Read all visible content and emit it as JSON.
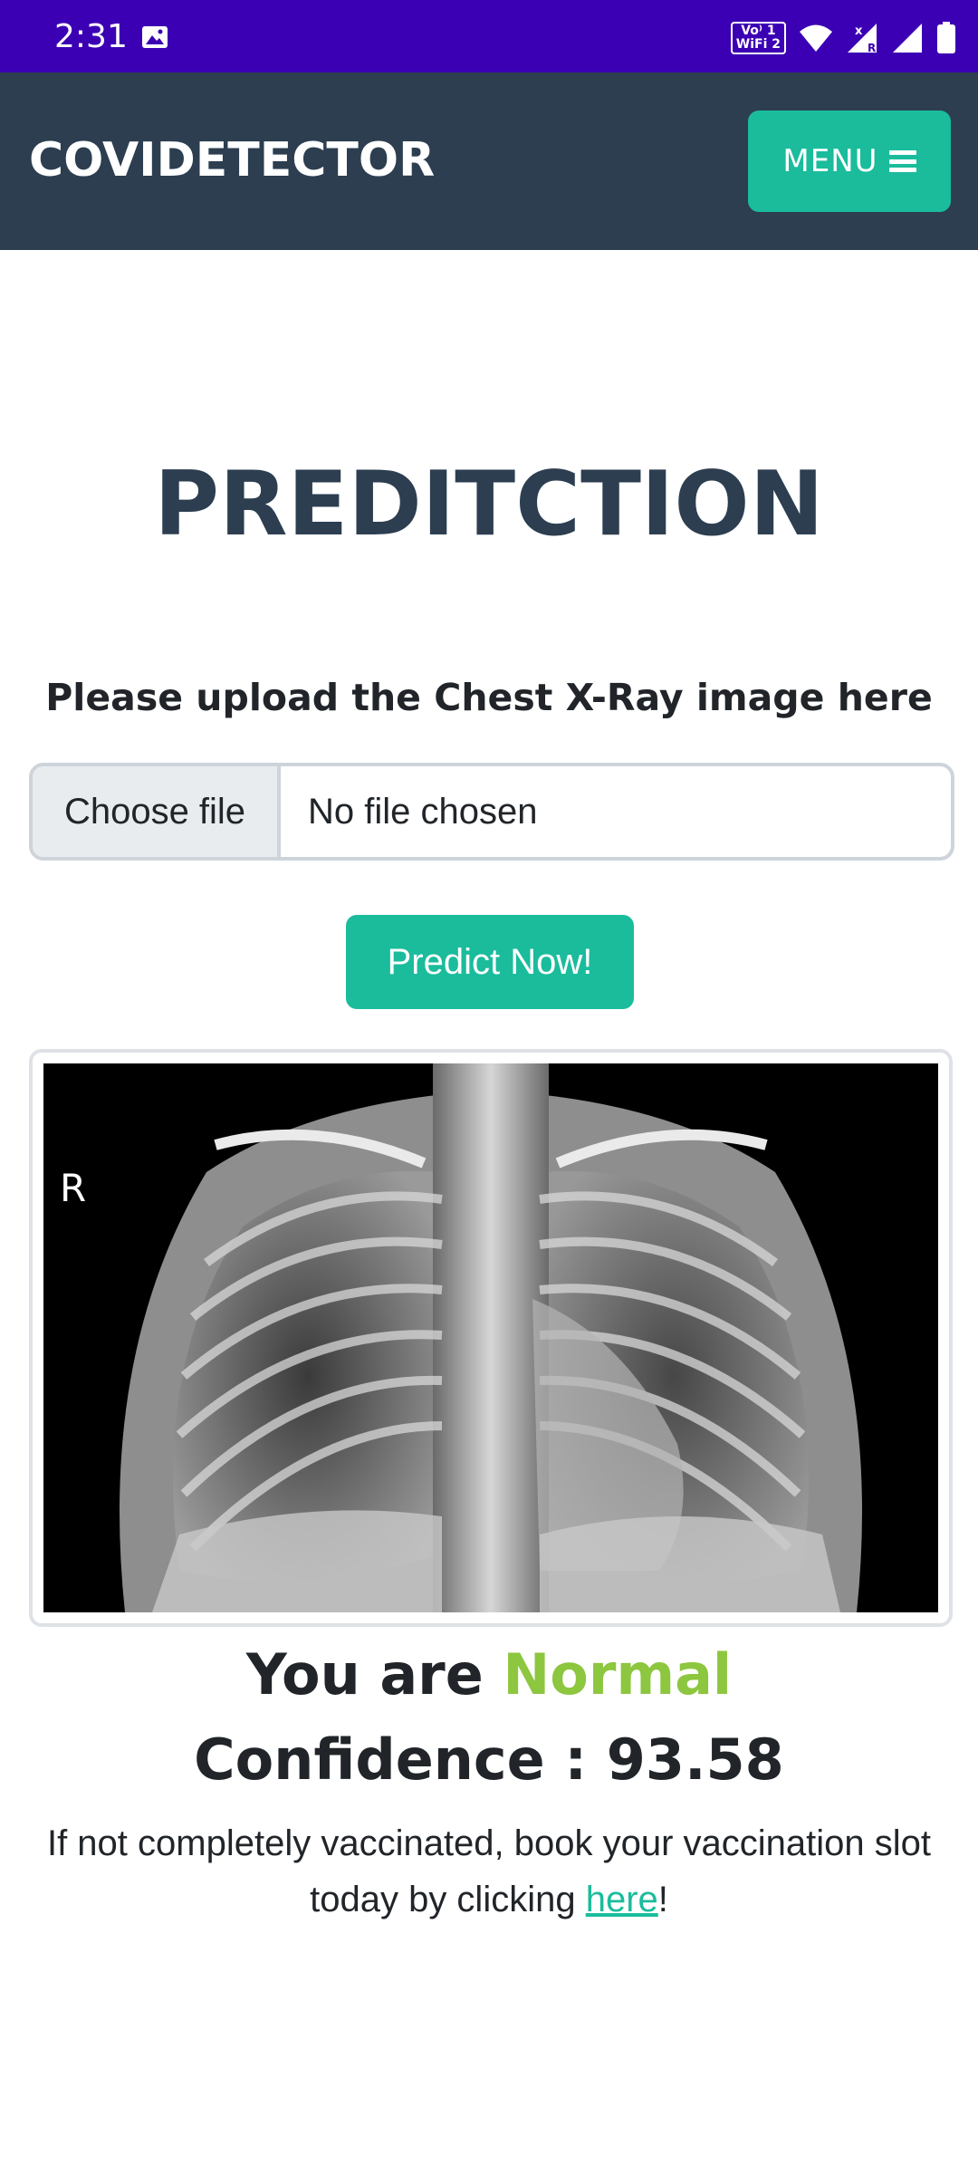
{
  "status_bar": {
    "time": "2:31",
    "network_badge_line1": "Vo⁾ 1",
    "network_badge_line2": "WiFi 2",
    "icons": [
      "gallery-icon",
      "wifi-icon",
      "signal-x-icon",
      "signal-icon",
      "battery-icon"
    ]
  },
  "navbar": {
    "brand": "COVIDETECTOR",
    "menu_label": "MENU",
    "menu_icon": "bars-icon"
  },
  "main": {
    "title": "PREDITCTION",
    "upload_label": "Please upload the Chest X-Ray image here",
    "file_button": "Choose file",
    "file_status": "No file chosen",
    "predict_button": "Predict Now!",
    "xray_marker": "R",
    "result_prefix": "You are",
    "result_value": "Normal",
    "confidence_text": "Confidence : 93.58",
    "vaccine_text_before": "If not completely vaccinated, book your vaccination slot today by clicking ",
    "vaccine_link": "here",
    "vaccine_text_after": "!"
  },
  "colors": {
    "status_bar": "#3c00b4",
    "navbar": "#2c3e50",
    "accent": "#1abc9c",
    "result_normal": "#8dc63f",
    "title": "#2c3e50"
  }
}
